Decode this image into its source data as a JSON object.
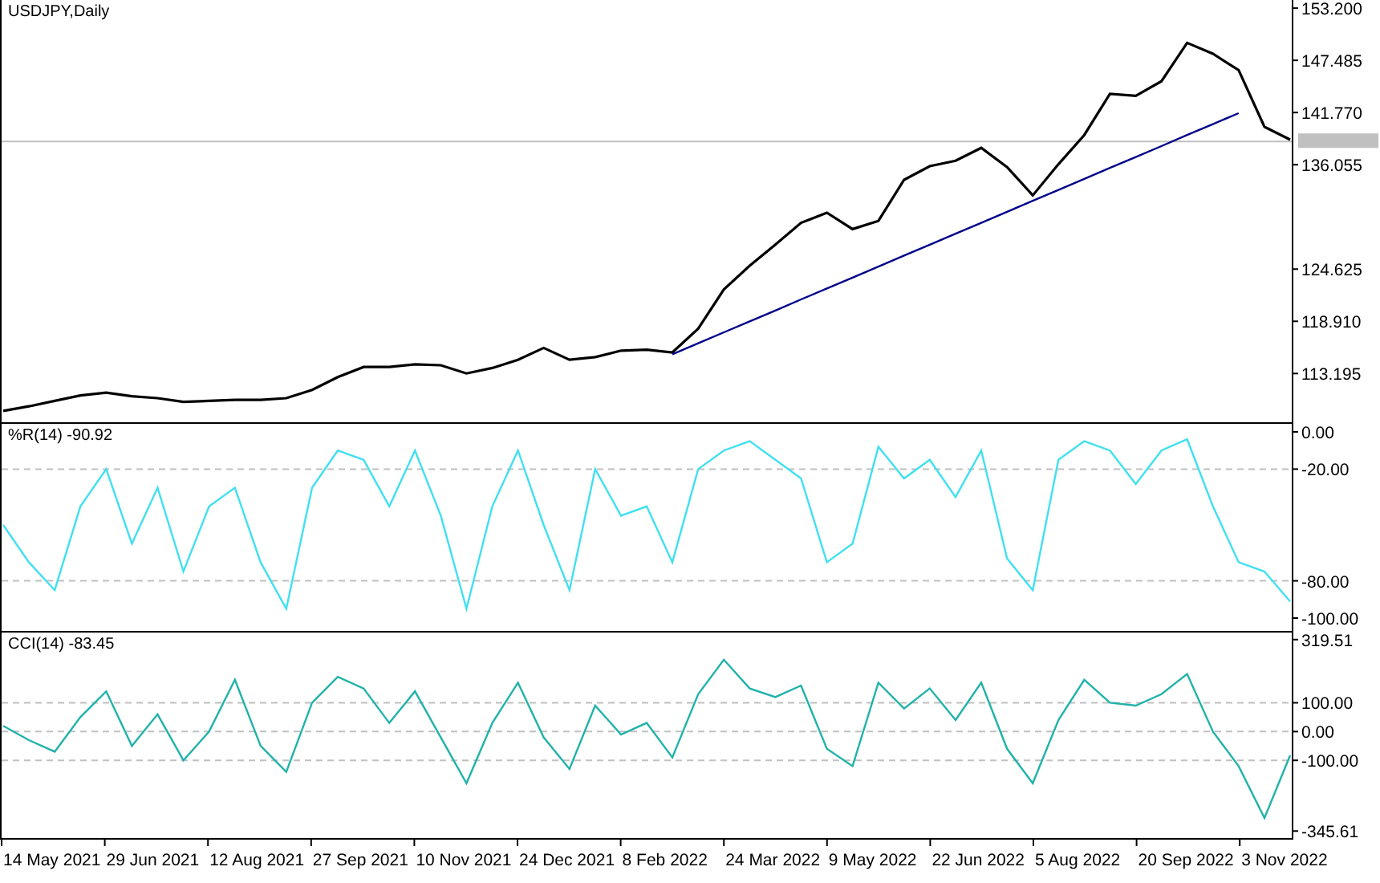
{
  "panels": [
    {
      "kind": "price",
      "chart_data": {
        "type": "line",
        "title": "USDJPY,Daily",
        "categories": [
          null,
          null,
          null,
          null,
          null,
          null,
          null,
          null,
          null,
          null,
          null,
          null,
          null,
          null,
          null,
          null,
          null,
          null,
          null,
          null,
          null,
          null,
          null,
          null,
          null,
          null,
          null,
          null,
          null,
          null,
          null,
          null,
          null,
          null,
          null,
          null,
          null,
          null,
          null,
          null,
          null,
          null,
          null,
          null,
          null,
          null,
          null,
          null,
          null,
          null,
          null
        ],
        "series": [
          {
            "color": "#000000",
            "values": [
              109.1,
              109.6,
              110.2,
              110.8,
              111.1,
              110.7,
              110.5,
              110.1,
              110.2,
              110.3,
              110.3,
              110.5,
              111.4,
              112.8,
              113.9,
              113.9,
              114.2,
              114.1,
              113.2,
              113.8,
              114.7,
              116.0,
              114.7,
              115.0,
              115.7,
              115.8,
              115.5,
              118.1,
              122.4,
              125.0,
              127.3,
              129.7,
              130.8,
              129.0,
              129.9,
              134.4,
              135.9,
              136.5,
              137.9,
              135.8,
              132.7,
              136.1,
              139.3,
              143.8,
              143.6,
              145.2,
              149.4,
              148.2,
              146.4,
              140.2,
              138.8
            ]
          },
          {
            "color": "#00008b",
            "values": [
              null,
              null,
              null,
              null,
              null,
              null,
              null,
              null,
              null,
              null,
              null,
              null,
              null,
              null,
              null,
              null,
              null,
              null,
              null,
              null,
              null,
              null,
              null,
              null,
              null,
              null,
              115.3,
              116.5,
              117.7,
              118.9,
              120.1,
              121.3,
              122.5,
              123.7,
              124.9,
              126.1,
              127.3,
              128.5,
              129.7,
              130.9,
              132.1,
              133.3,
              134.5,
              135.7,
              136.9,
              138.1,
              139.3,
              140.5,
              141.7,
              null,
              null
            ]
          }
        ],
        "ylim": [
          107.86,
          154.09
        ],
        "yticks": [
          {
            "value": 153.2,
            "label": "153.200"
          },
          {
            "value": 147.485,
            "label": "147.485"
          },
          {
            "value": 141.77,
            "label": "141.770"
          },
          {
            "value": 136.055,
            "label": "136.055"
          },
          {
            "value": 124.625,
            "label": "124.625"
          },
          {
            "value": 118.91,
            "label": "118.910"
          },
          {
            "value": 113.195,
            "label": "113.195"
          }
        ],
        "ref_lines": [
          {
            "axis": "y",
            "value": 138.6
          }
        ]
      }
    },
    {
      "kind": "oscillator",
      "chart_data": {
        "type": "line",
        "title": "%R(14) -90.92",
        "categories": [
          null,
          null,
          null,
          null,
          null,
          null,
          null,
          null,
          null,
          null,
          null,
          null,
          null,
          null,
          null,
          null,
          null,
          null,
          null,
          null,
          null,
          null,
          null,
          null,
          null,
          null,
          null,
          null,
          null,
          null,
          null,
          null,
          null,
          null,
          null,
          null,
          null,
          null,
          null,
          null,
          null,
          null,
          null,
          null,
          null,
          null,
          null,
          null,
          null,
          null,
          null
        ],
        "series": [
          {
            "color": "#40e0f0",
            "values": [
              -50,
              -70,
              -85,
              -40,
              -20,
              -60,
              -30,
              -75,
              -40,
              -30,
              -70,
              -95,
              -30,
              -10,
              -15,
              -40,
              -10,
              -45,
              -95,
              -40,
              -10,
              -50,
              -85,
              -20,
              -45,
              -40,
              -70,
              -20,
              -10,
              -5,
              -15,
              -25,
              -70,
              -60,
              -8,
              -25,
              -15,
              -35,
              -10,
              -68,
              -85,
              -15,
              -5,
              -10,
              -28,
              -10,
              -4,
              -40,
              -70,
              -75,
              -91
            ]
          }
        ],
        "ylim": [
          -106.9,
          4.3
        ],
        "yticks": [
          {
            "value": 0,
            "label": "0.00"
          },
          {
            "value": -20,
            "label": "-20.00"
          },
          {
            "value": -80,
            "label": "-80.00"
          },
          {
            "value": -100,
            "label": "-100.00"
          }
        ],
        "ref_lines": [
          {
            "axis": "y",
            "value": -20
          },
          {
            "axis": "y",
            "value": -80
          }
        ]
      }
    },
    {
      "kind": "oscillator",
      "chart_data": {
        "type": "line",
        "title": "CCI(14) -83.45",
        "categories": [
          null,
          null,
          null,
          null,
          null,
          null,
          null,
          null,
          null,
          null,
          null,
          null,
          null,
          null,
          null,
          null,
          null,
          null,
          null,
          null,
          null,
          null,
          null,
          null,
          null,
          null,
          null,
          null,
          null,
          null,
          null,
          null,
          null,
          null,
          null,
          null,
          null,
          null,
          null,
          null,
          null,
          null,
          null,
          null,
          null,
          null,
          null,
          null,
          null,
          null,
          null
        ],
        "series": [
          {
            "color": "#20b2aa",
            "values": [
              20,
              -30,
              -70,
              50,
              140,
              -50,
              60,
              -100,
              0,
              180,
              -50,
              -140,
              100,
              190,
              150,
              30,
              140,
              -20,
              -180,
              30,
              170,
              -20,
              -130,
              90,
              -10,
              30,
              -90,
              130,
              250,
              150,
              120,
              160,
              -60,
              -120,
              170,
              80,
              150,
              40,
              170,
              -60,
              -180,
              40,
              180,
              100,
              90,
              130,
              200,
              0,
              -120,
              -300,
              -83
            ]
          }
        ],
        "ylim": [
          -370,
          344
        ],
        "yticks": [
          {
            "value": 319.51,
            "label": "319.51"
          },
          {
            "value": 100,
            "label": "100.00"
          },
          {
            "value": 0,
            "label": "0.00"
          },
          {
            "value": -100,
            "label": "-100.00"
          },
          {
            "value": -345.61,
            "label": "-345.61"
          }
        ],
        "ref_lines": [
          {
            "axis": "y",
            "value": 100
          },
          {
            "axis": "y",
            "value": 0
          },
          {
            "axis": "y",
            "value": -100
          }
        ]
      }
    }
  ],
  "time_axis": {
    "ticks": [
      "14 May 2021",
      "29 Jun 2021",
      "12 Aug 2021",
      "27 Sep 2021",
      "10 Nov 2021",
      "24 Dec 2021",
      "8 Feb 2022",
      "24 Mar 2022",
      "9 May 2022",
      "22 Jun 2022",
      "5 Aug 2022",
      "20 Sep 2022",
      "3 Nov 2022"
    ]
  }
}
